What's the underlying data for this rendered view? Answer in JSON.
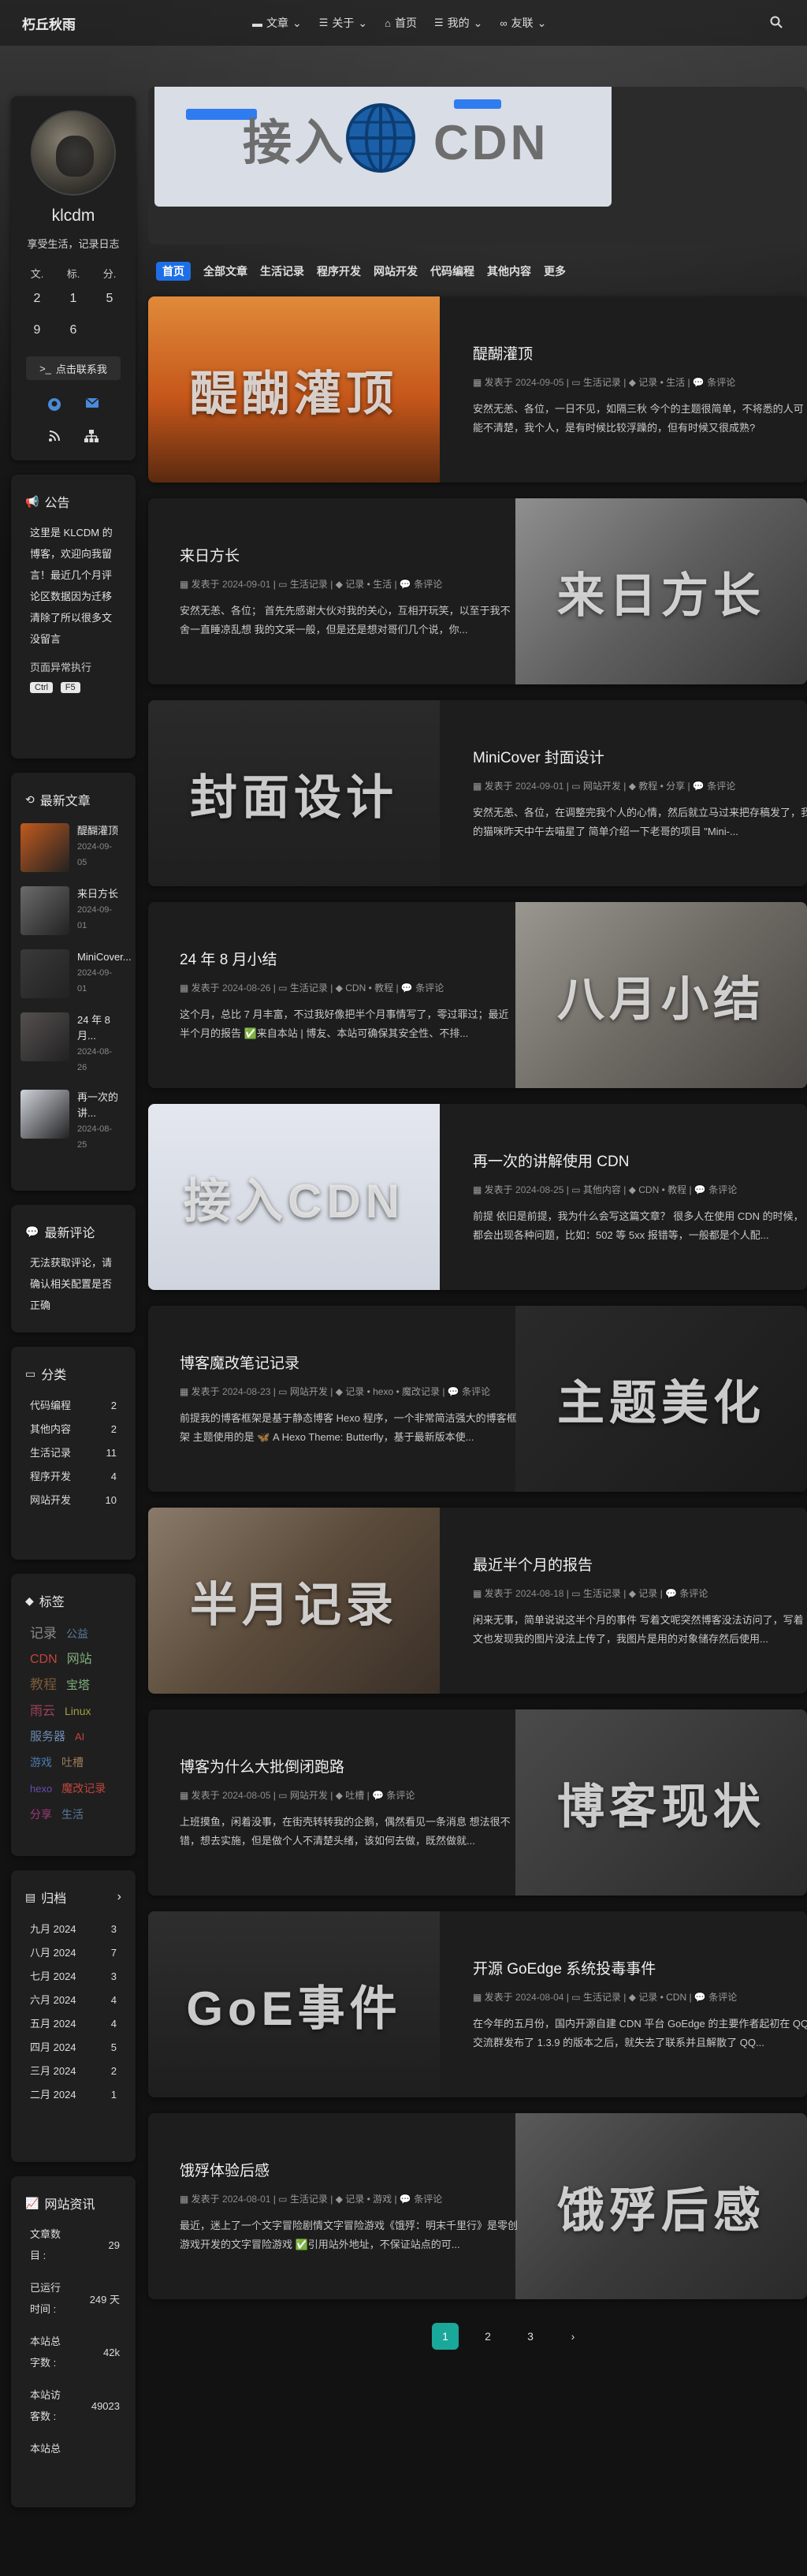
{
  "nav": {
    "brand": "朽丘秋雨",
    "menu": [
      {
        "icon": "folder-icon",
        "label": "文章"
      },
      {
        "icon": "list-icon",
        "label": "关于"
      },
      {
        "icon": "home-icon",
        "label": "首页"
      },
      {
        "icon": "list-icon",
        "label": "我的"
      },
      {
        "icon": "link-icon",
        "label": "友联"
      }
    ]
  },
  "profile": {
    "name": "klcdm",
    "desc": "享受生活，记录日志",
    "stats": [
      {
        "label": "文.",
        "value_top": "2",
        "value_bottom": "9"
      },
      {
        "label": "标.",
        "value_top": "1",
        "value_bottom": "6"
      },
      {
        "label": "分.",
        "value_top": "5",
        "value_bottom": ""
      }
    ],
    "contact": "点击联系我"
  },
  "announce": {
    "title": "公告",
    "text": "这里是 KLCDM 的博客，欢迎向我留言！最近几个月评论区数据因为迁移清除了所以很多文没留言",
    "tip": "页面异常执行",
    "keys": [
      "Ctrl",
      "F5"
    ]
  },
  "recent": {
    "title": "最新文章",
    "items": [
      {
        "title": "醍醐灌顶",
        "date": "2024-09-05",
        "color": "#c15a1e"
      },
      {
        "title": "来日方长",
        "date": "2024-09-01",
        "color": "#6b6b6b"
      },
      {
        "title": "MiniCover...",
        "date": "2024-09-01",
        "color": "#3a3a3a"
      },
      {
        "title": "24 年 8 月...",
        "date": "2024-08-26",
        "color": "#555050"
      },
      {
        "title": "再一次的讲...",
        "date": "2024-08-25",
        "color": "#cfd3db"
      }
    ]
  },
  "comments": {
    "title": "最新评论",
    "text": "无法获取评论，请确认相关配置是否正确"
  },
  "categories": {
    "title": "分类",
    "items": [
      {
        "name": "代码编程",
        "count": "2"
      },
      {
        "name": "其他内容",
        "count": "2"
      },
      {
        "name": "生活记录",
        "count": "11"
      },
      {
        "name": "程序开发",
        "count": "4"
      },
      {
        "name": "网站开发",
        "count": "10"
      }
    ]
  },
  "tags": {
    "title": "标签",
    "items": [
      {
        "name": "记录",
        "color": "#8a8a8a",
        "size": 17
      },
      {
        "name": "公益",
        "color": "#5a7a9a",
        "size": 14
      },
      {
        "name": "CDN",
        "color": "#c0453c",
        "size": 16
      },
      {
        "name": "网站",
        "color": "#7fae7a",
        "size": 16
      },
      {
        "name": "教程",
        "color": "#7a5a3a",
        "size": 17
      },
      {
        "name": "宝塔",
        "color": "#7fae7a",
        "size": 15
      },
      {
        "name": "雨云",
        "color": "#a0405a",
        "size": 16
      },
      {
        "name": "Linux",
        "color": "#a0a040",
        "size": 14
      },
      {
        "name": "服务器",
        "color": "#6a8ab0",
        "size": 15
      },
      {
        "name": "AI",
        "color": "#c0453c",
        "size": 13
      },
      {
        "name": "游戏",
        "color": "#4a7ab0",
        "size": 14
      },
      {
        "name": "吐槽",
        "color": "#9a7a5a",
        "size": 14
      },
      {
        "name": "hexo",
        "color": "#6a4ab0",
        "size": 13
      },
      {
        "name": "魔改记录",
        "color": "#c0453c",
        "size": 14
      },
      {
        "name": "分享",
        "color": "#a03a7a",
        "size": 14
      },
      {
        "name": "生活",
        "color": "#5a7a9a",
        "size": 14
      }
    ]
  },
  "archive": {
    "title": "归档",
    "items": [
      {
        "name": "九月 2024",
        "count": "3"
      },
      {
        "name": "八月 2024",
        "count": "7"
      },
      {
        "name": "七月 2024",
        "count": "3"
      },
      {
        "name": "六月 2024",
        "count": "4"
      },
      {
        "name": "五月 2024",
        "count": "4"
      },
      {
        "name": "四月 2024",
        "count": "5"
      },
      {
        "name": "三月 2024",
        "count": "2"
      },
      {
        "name": "二月 2024",
        "count": "1"
      }
    ]
  },
  "site_info": {
    "title": "网站资讯",
    "items": [
      {
        "label": "文章数目 :",
        "value": "29"
      },
      {
        "label": "已运行时间 :",
        "value": "249 天"
      },
      {
        "label": "本站总字数 :",
        "value": "42k"
      },
      {
        "label": "本站访客数 :",
        "value": "49023"
      },
      {
        "label": "本站总",
        "value": ""
      }
    ]
  },
  "banner": {
    "text_left": "接入",
    "text_right": "CDN"
  },
  "tabs": [
    "首页",
    "全部文章",
    "生活记录",
    "程序开发",
    "网站开发",
    "代码编程",
    "其他内容",
    "更多"
  ],
  "posts": [
    {
      "side": "left",
      "cover_text": "醍醐灌顶",
      "cover_bg": "linear-gradient(180deg,#e08a3a 0%,#c5561a 55%,#5a2a10 100%)",
      "title": "醍醐灌顶",
      "date": "2024-09-05",
      "category": "生活记录",
      "tags": "记录 • 生活",
      "comments": "条评论",
      "excerpt": "安然无恙、各位，一日不见，如隔三秋 今个的主题很简单，不将悉的人可能不清楚，我个人，是有时候比较浮躁的，但有时候又很成熟?"
    },
    {
      "side": "right",
      "cover_text": "来日方长",
      "cover_bg": "linear-gradient(135deg,#8f8f8f 0%,#5e5e5e 50%,#3a3a3a 100%)",
      "title": "来日方长",
      "date": "2024-09-01",
      "category": "生活记录",
      "tags": "记录 • 生活",
      "comments": "条评论",
      "excerpt": "安然无恙、各位； 首先先感谢大伙对我的关心，互相开玩笑，以至于我不舍一直睡凉乱想 我的文采一般，但是还是想对哥们几个说，你..."
    },
    {
      "side": "left",
      "cover_text": "封面设计",
      "cover_bg": "linear-gradient(180deg,#2a2a2a 0%,#1f1f1f 100%)",
      "title": "MiniCover 封面设计",
      "date": "2024-09-01",
      "category": "网站开发",
      "tags": "教程 • 分享",
      "comments": "条评论",
      "excerpt": "安然无恙、各位，在调整完我个人的心情，然后就立马过来把存稿发了，我的猫咪昨天中午去喵星了 简单介绍一下老哥的项目 \"Mini-..."
    },
    {
      "side": "right",
      "cover_text": "八月小结",
      "cover_bg": "linear-gradient(135deg,#9a9690 0%,#6e6a64 50%,#4a4744 100%)",
      "title": "24 年 8 月小结",
      "date": "2024-08-26",
      "category": "生活记录",
      "tags": "CDN • 教程",
      "comments": "条评论",
      "excerpt": "这个月，总比 7 月丰富，不过我好像把半个月事情写了，零过罪过；最近半个月的报告 ✅来自本站 | 博友、本站可确保其安全性、不排..."
    },
    {
      "side": "left",
      "cover_text": "接入CDN",
      "cover_bg": "linear-gradient(180deg,#e4e7ee 0%,#cfd4de 100%)",
      "title": "再一次的讲解使用 CDN",
      "date": "2024-08-25",
      "category": "其他内容",
      "tags": "CDN • 教程",
      "comments": "条评论",
      "excerpt": "前提 依旧是前提，我为什么会写这篇文章？ 很多人在使用 CDN 的时候，都会出现各种问题，比如：502 等 5xx 报错等，一般都是个人配..."
    },
    {
      "side": "right",
      "cover_text": "主题美化",
      "cover_bg": "linear-gradient(135deg,#2a2a2a 0%,#1a1a1a 100%)",
      "title": "博客魔改笔记记录",
      "date": "2024-08-23",
      "category": "网站开发",
      "tags": "记录 • hexo • 魔改记录",
      "comments": "条评论",
      "excerpt": "前提我的博客框架是基于静态博客 Hexo 程序，一个非常简洁强大的博客框架 主题使用的是 🦋 A Hexo Theme: Butterfly，基于最新版本使..."
    },
    {
      "side": "left",
      "cover_text": "半月记录",
      "cover_bg": "linear-gradient(135deg,#8a7a6a 0%,#5a4a3a 50%,#3a3028 100%)",
      "title": "最近半个月的报告",
      "date": "2024-08-18",
      "category": "生活记录",
      "tags": "记录",
      "comments": "条评论",
      "excerpt": "闲来无事，简单说说这半个月的事件 写着文呢突然博客没法访问了，写着文也发现我的图片没法上传了，我图片是用的对象储存然后使用..."
    },
    {
      "side": "right",
      "cover_text": "博客现状",
      "cover_bg": "linear-gradient(135deg,#4a4a4a 0%,#2a2a2a 100%)",
      "title": "博客为什么大批倒闭跑路",
      "date": "2024-08-05",
      "category": "网站开发",
      "tags": "吐槽",
      "comments": "条评论",
      "excerpt": "上班摸鱼，闲着没事，在街壳转转我的企鹅，偶然看见一条消息 想法很不错，想去实施，但是做个人不清楚头绪，该如何去做，既然做就..."
    },
    {
      "side": "left",
      "cover_text": "GoE事件",
      "cover_bg": "linear-gradient(180deg,#2e2e2e 0%,#1e1e1e 100%)",
      "title": "开源 GoEdge 系统投毒事件",
      "date": "2024-08-04",
      "category": "生活记录",
      "tags": "记录 • CDN",
      "comments": "条评论",
      "excerpt": "在今年的五月份，国内开源自建 CDN 平台 GoEdge 的主要作者起初在 QQ 交流群发布了 1.3.9 的版本之后，就失去了联系并且解散了 QQ..."
    },
    {
      "side": "right",
      "cover_text": "饿殍后感",
      "cover_bg": "linear-gradient(135deg,#5a5a5a 0%,#3a3a3a 50%,#2a2a2a 100%)",
      "title": "饿殍体验后感",
      "date": "2024-08-01",
      "category": "生活记录",
      "tags": "记录 • 游戏",
      "comments": "条评论",
      "excerpt": "最近，迷上了一个文字冒险剧情文字冒险游戏《饿殍：明末千里行》是零创游戏开发的文字冒险游戏 ✅引用站外地址，不保证站点的可..."
    }
  ],
  "pagination": [
    "1",
    "2",
    "3",
    "›"
  ],
  "meta_labels": {
    "posted": "发表于"
  }
}
